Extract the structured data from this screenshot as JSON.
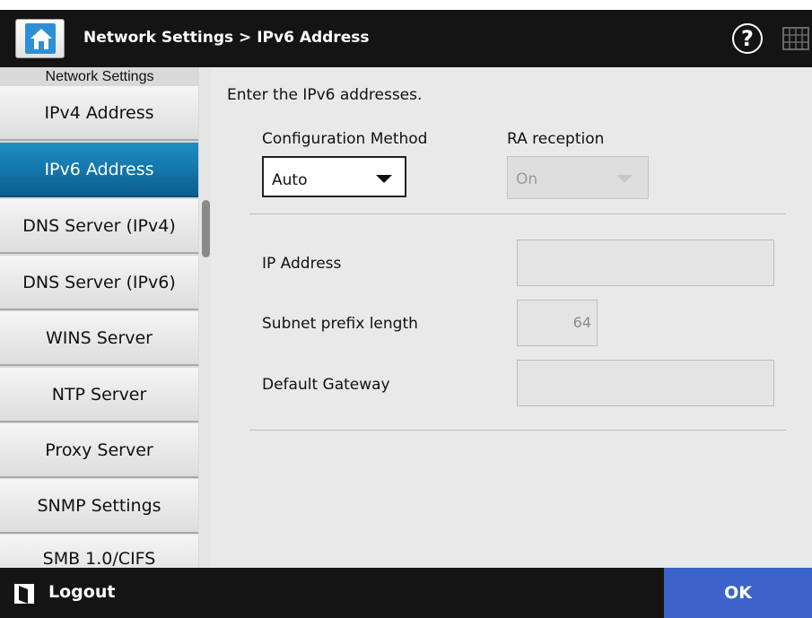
{
  "header": {
    "breadcrumb": "Network Settings > IPv6 Address",
    "help_label": "?",
    "home_icon": "home-icon",
    "keyboard_icon": "keyboard-icon"
  },
  "sidebar": {
    "heading": "Network Settings",
    "items": [
      {
        "label": "IPv4 Address",
        "active": false
      },
      {
        "label": "IPv6 Address",
        "active": true
      },
      {
        "label": "DNS Server (IPv4)",
        "active": false
      },
      {
        "label": "DNS Server (IPv6)",
        "active": false
      },
      {
        "label": "WINS Server",
        "active": false
      },
      {
        "label": "NTP Server",
        "active": false
      },
      {
        "label": "Proxy Server",
        "active": false
      },
      {
        "label": "SNMP Settings",
        "active": false
      },
      {
        "label": "SMB 1.0/CIFS",
        "active": false
      }
    ]
  },
  "main": {
    "instruction": "Enter the IPv6 addresses.",
    "config_method": {
      "label": "Configuration Method",
      "value": "Auto"
    },
    "ra_reception": {
      "label": "RA reception",
      "value": "On",
      "disabled": true
    },
    "ip_address": {
      "label": "IP Address",
      "value": ""
    },
    "subnet_prefix": {
      "label": "Subnet prefix length",
      "value": "64"
    },
    "default_gateway": {
      "label": "Default Gateway",
      "value": ""
    }
  },
  "footer": {
    "logout_label": "Logout",
    "ok_label": "OK"
  },
  "colors": {
    "header_bg": "#141414",
    "active_item": "#0a6ea4",
    "ok_button": "#3b63c9",
    "panel_bg": "#e9e9e9"
  }
}
